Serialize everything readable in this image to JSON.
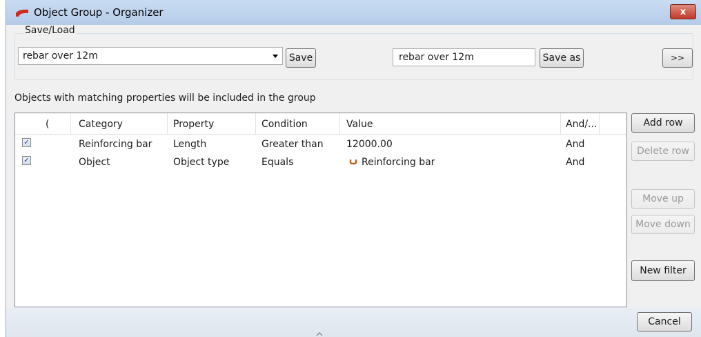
{
  "window": {
    "title": "Object Group - Organizer",
    "close_label": "x"
  },
  "save_load": {
    "legend": "Save/Load",
    "selected": "rebar over 12m",
    "save_label": "Save",
    "name_value": "rebar over 12m",
    "save_as_label": "Save as",
    "expand_label": ">>"
  },
  "hint": "Objects with matching properties will be included in the group",
  "grid": {
    "headers": [
      "(",
      "Category",
      "Property",
      "Condition",
      "Value",
      "And/..."
    ],
    "rows": [
      {
        "checked": "✓",
        "category": "Reinforcing bar",
        "property": "Length",
        "condition": "Greater than",
        "value": "12000.00",
        "andor": "And"
      },
      {
        "checked": "✓",
        "category": "Object",
        "property": "Object type",
        "condition": "Equals",
        "value": "Reinforcing bar",
        "andor": "And"
      }
    ]
  },
  "side_buttons": {
    "add_row": "Add row",
    "delete_row": "Delete row",
    "move_up": "Move up",
    "move_down": "Move down",
    "new_filter": "New filter",
    "cancel": "Cancel"
  },
  "icons": {
    "app": "organizer-icon",
    "rebar": "rebar-icon",
    "close": "close-icon"
  },
  "colors": {
    "title_bar": "#b4cbe8",
    "close_button": "#c2392a",
    "app_icon": "#cc2b1d",
    "rebar_icon": "#b4611f"
  }
}
